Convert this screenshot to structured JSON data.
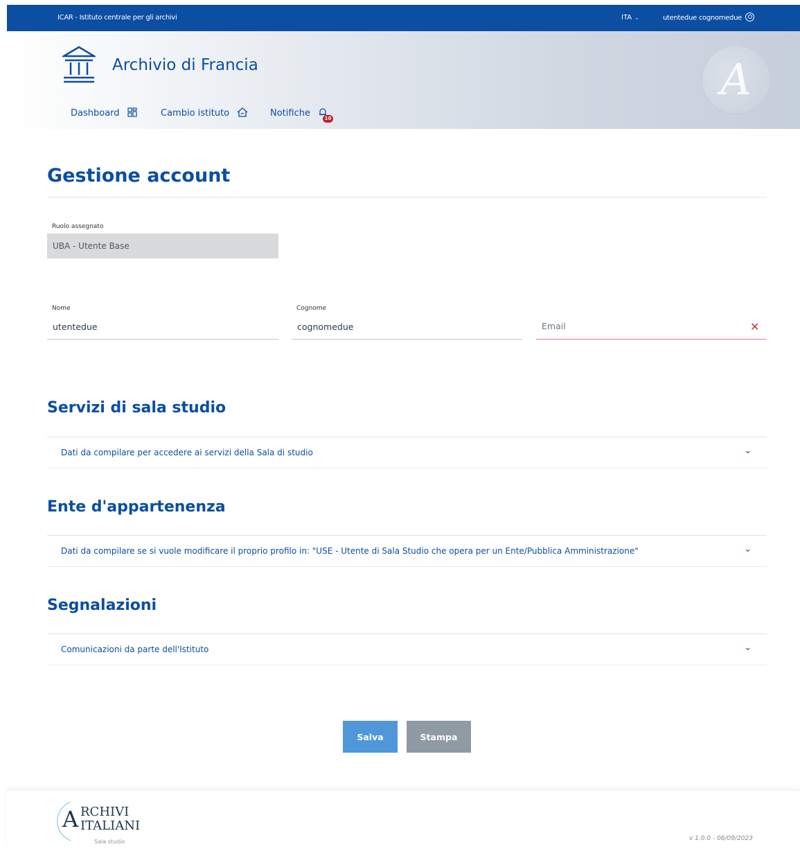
{
  "topbar": {
    "org": "ICAR - Istituto centrale per gli archivi",
    "lang": "ITA",
    "user": "utentedue cognomedue"
  },
  "header": {
    "title": "Archivio di Francia",
    "monogram": "A",
    "nav": [
      {
        "label": "Dashboard"
      },
      {
        "label": "Cambio istituto"
      },
      {
        "label": "Notifiche",
        "badge": "10"
      }
    ]
  },
  "page": {
    "title": "Gestione account",
    "role": {
      "label": "Ruolo assegnato",
      "value": "UBA - Utente Base"
    },
    "nome": {
      "label": "Nome",
      "value": "utentedue"
    },
    "cognome": {
      "label": "Cognome",
      "value": "cognomedue"
    },
    "email": {
      "placeholder": "Email",
      "value": ""
    }
  },
  "sections": [
    {
      "title": "Servizi di sala studio",
      "accordion": "Dati da compilare per accedere ai servizi della Sala di studio"
    },
    {
      "title": "Ente d'appartenenza",
      "accordion": "Dati da compilare se si vuole modificare il proprio profilo in: \"USE - Utente di Sala Studio che opera per un Ente/Pubblica Amministrazione\""
    },
    {
      "title": "Segnalazioni",
      "accordion": "Comunicazioni da parte dell'Istituto"
    }
  ],
  "actions": {
    "save": "Salva",
    "print": "Stampa"
  },
  "footer": {
    "logo_line1": "RCHIVI",
    "logo_line2": "ITALIANI",
    "logo_initial": "A",
    "logo_sub": "Sala studio",
    "version": "v 1.0.0 - 06/09/2023"
  },
  "colors": {
    "primary": "#0b4ea2",
    "error": "#d0303a",
    "save": "#4f97d9",
    "print": "#8f9aa5"
  }
}
